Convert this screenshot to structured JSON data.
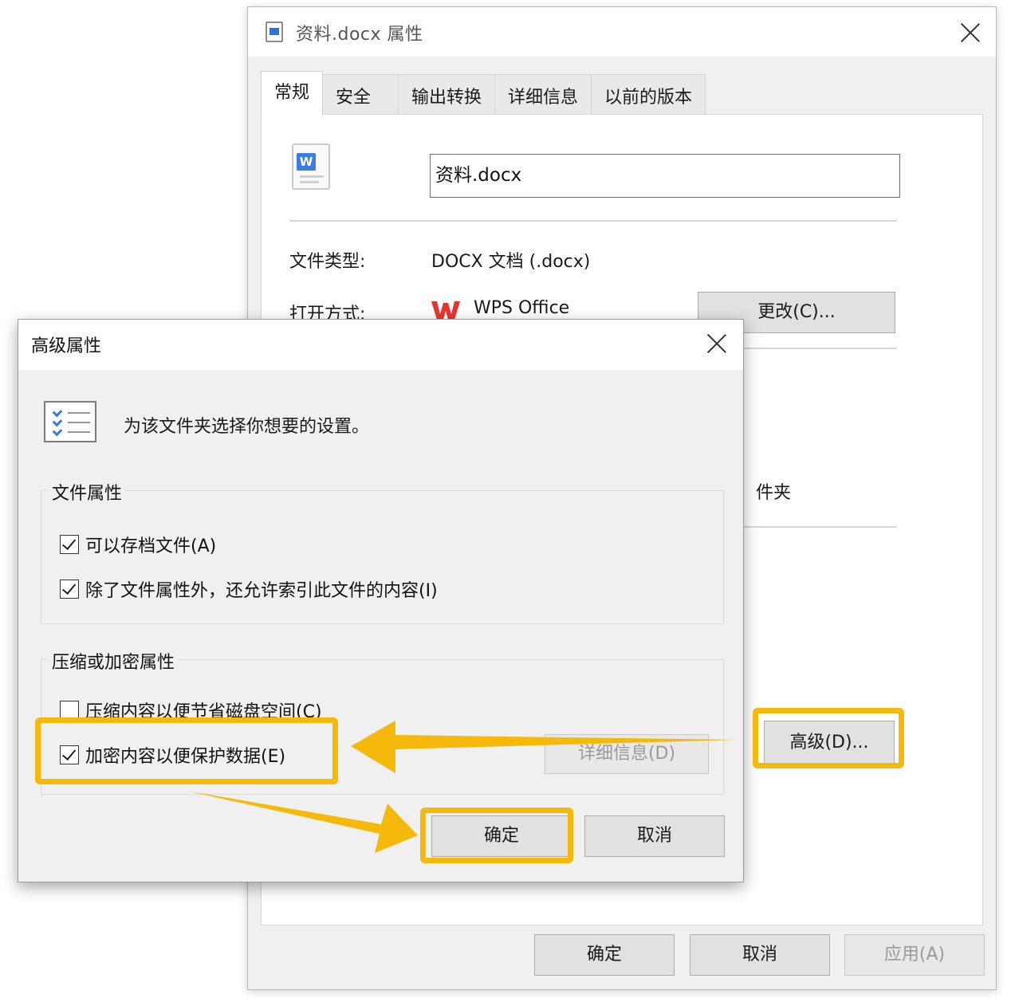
{
  "props_window": {
    "title": "资料.docx 属性",
    "tabs": [
      "常规",
      "安全",
      "输出转换",
      "详细信息",
      "以前的版本"
    ],
    "filename": "资料.docx",
    "file_type_label": "文件类型:",
    "file_type_value": "DOCX 文档 (.docx)",
    "open_with_label": "打开方式:",
    "open_with_value": "WPS Office",
    "change_button": "更改(C)...",
    "folder_fragment": "件夹",
    "advanced_button": "高级(D)...",
    "ok_button": "确定",
    "cancel_button": "取消",
    "apply_button": "应用(A)"
  },
  "adv_dialog": {
    "title": "高级属性",
    "description": "为该文件夹选择你想要的设置。",
    "file_attributes_group": "文件属性",
    "archive_checkbox": {
      "label": "可以存档文件(A)",
      "checked": true
    },
    "index_checkbox": {
      "label": "除了文件属性外，还允许索引此文件的内容(I)",
      "checked": true
    },
    "compress_encrypt_group": "压缩或加密属性",
    "compress_checkbox": {
      "label": "压缩内容以便节省磁盘空间(C)",
      "checked": false
    },
    "encrypt_checkbox": {
      "label": "加密内容以便保护数据(E)",
      "checked": true
    },
    "details_button": "详细信息(D)",
    "ok_button": "确定",
    "cancel_button": "取消"
  },
  "colors": {
    "highlight": "#f5b90c",
    "wps_red": "#e8352c",
    "accent_blue": "#2f73d9"
  }
}
